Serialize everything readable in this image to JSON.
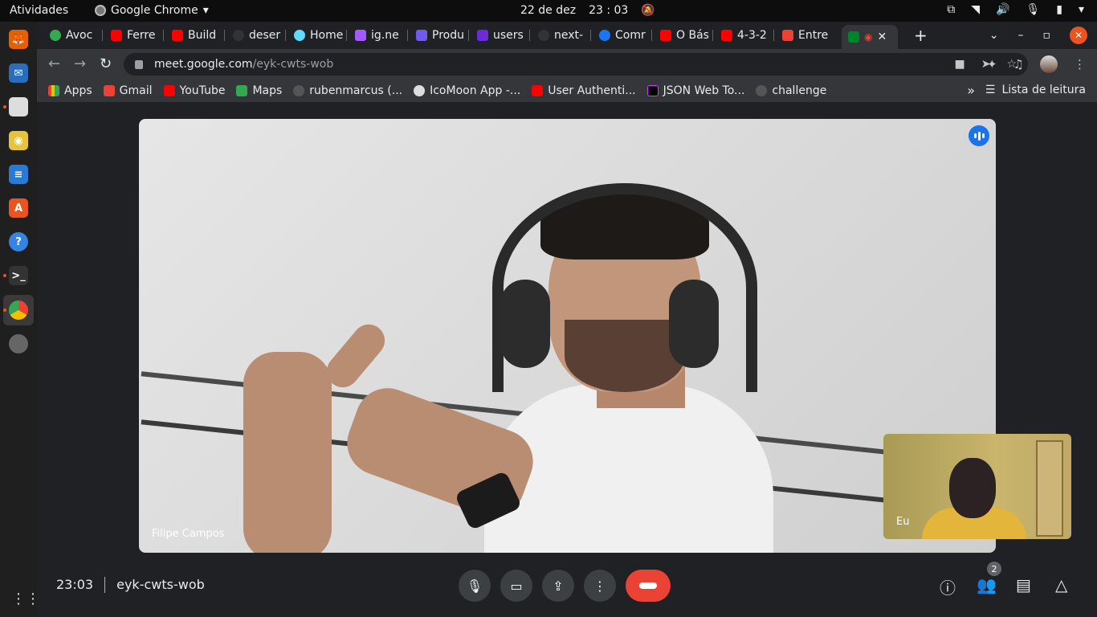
{
  "os": {
    "activities": "Atividades",
    "app_name": "Google Chrome",
    "date": "22 de dez",
    "time": "23 : 03"
  },
  "tabs": [
    {
      "label": "Avoc",
      "color": "#34a853"
    },
    {
      "label": "Ferre",
      "color": "#ff0000"
    },
    {
      "label": "Build",
      "color": "#ff0000"
    },
    {
      "label": "deser",
      "color": "#333333"
    },
    {
      "label": "Home",
      "color": "#61dafb"
    },
    {
      "label": "ig.ne",
      "color": "#a259ff"
    },
    {
      "label": "Produ",
      "color": "#6c5ce7"
    },
    {
      "label": "users",
      "color": "#6c2bd9"
    },
    {
      "label": "next-",
      "color": "#333333"
    },
    {
      "label": "Comr",
      "color": "#1877f2"
    },
    {
      "label": "O Bás",
      "color": "#ff0000"
    },
    {
      "label": "4-3-2",
      "color": "#ff0000"
    },
    {
      "label": "Entre",
      "color": "#ea4335"
    },
    {
      "label": "",
      "color": "#00832d"
    }
  ],
  "address": {
    "domain": "meet.google.com",
    "path": "/eyk-cwts-wob"
  },
  "bookmarks": [
    {
      "label": "Apps",
      "color": "#ea4335"
    },
    {
      "label": "Gmail",
      "color": "#ea4335"
    },
    {
      "label": "YouTube",
      "color": "#ff0000"
    },
    {
      "label": "Maps",
      "color": "#34a853"
    },
    {
      "label": "rubenmarcus (...",
      "color": "#555555"
    },
    {
      "label": "IcoMoon App -...",
      "color": "#dddddd"
    },
    {
      "label": "User Authenti...",
      "color": "#ff0000"
    },
    {
      "label": "JSON Web To...",
      "color": "#000000"
    },
    {
      "label": "challenge",
      "color": "#555555"
    }
  ],
  "reading_list": "Lista de leitura",
  "meet": {
    "main_participant": "Filipe Campos",
    "self_label": "Eu",
    "clock": "23:03",
    "meeting_code": "eyk-cwts-wob",
    "participants_count": "2"
  }
}
